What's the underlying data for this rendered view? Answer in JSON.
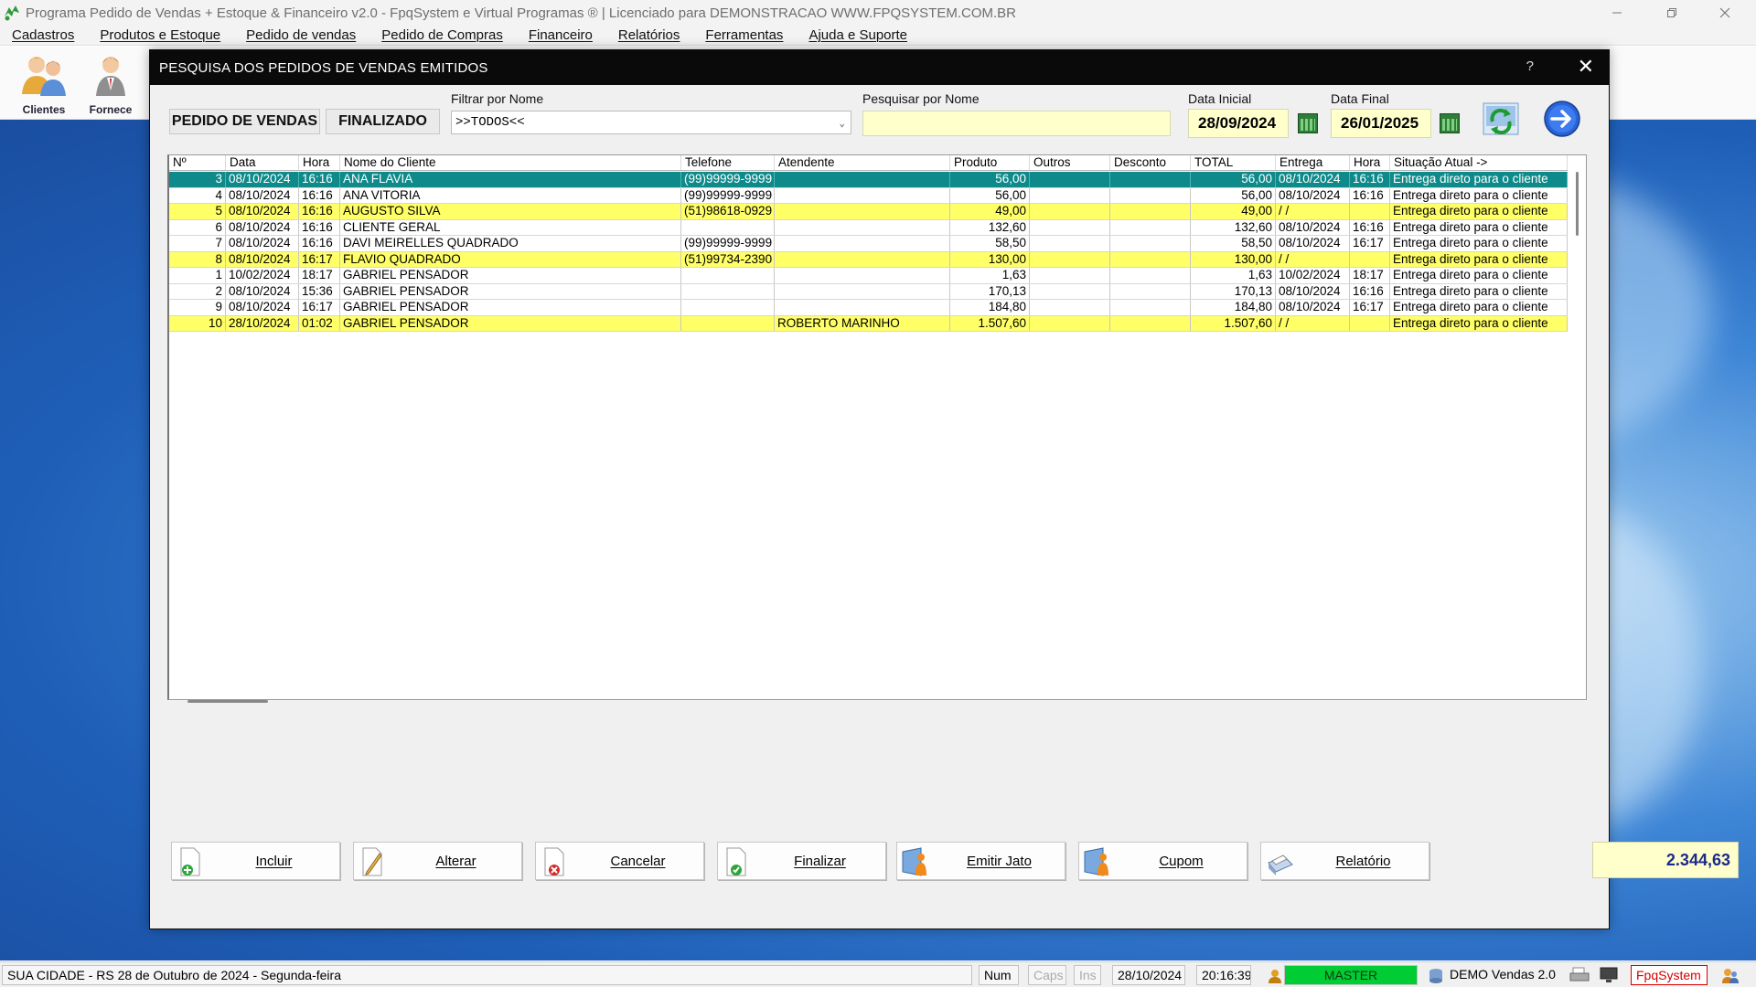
{
  "window": {
    "title": "Programa Pedido de Vendas + Estoque & Financeiro v2.0 - FpqSystem e Virtual Programas ® | Licenciado para  DEMONSTRACAO WWW.FPQSYSTEM.COM.BR"
  },
  "menu": [
    "Cadastros",
    "Produtos e Estoque",
    "Pedido de vendas",
    "Pedido de Compras",
    "Financeiro",
    "Relatórios",
    "Ferramentas",
    "Ajuda e Suporte"
  ],
  "toolbar": {
    "clientes": "Clientes",
    "fornece": "Fornece"
  },
  "dialog": {
    "title": "PESQUISA DOS PEDIDOS DE VENDAS EMITIDOS",
    "help": "?",
    "close": "✕",
    "btn_pedido": "PEDIDO DE VENDAS",
    "btn_finalizado": "FINALIZADO",
    "filtrar_label": "Filtrar por Nome",
    "filtrar_value": ">>TODOS<<",
    "pesquisar_label": "Pesquisar por Nome",
    "pesquisar_value": "",
    "data_inicial_label": "Data Inicial",
    "data_inicial": "28/09/2024",
    "data_final_label": "Data Final",
    "data_final": "26/01/2025"
  },
  "grid": {
    "columns": [
      "Nº",
      "Data",
      "Hora",
      "Nome do Cliente",
      "Telefone",
      "Atendente",
      "Produto",
      "Outros",
      "Desconto",
      "TOTAL",
      "Entrega",
      "Hora",
      "Situação Atual   ->"
    ],
    "rows": [
      {
        "n": "3",
        "data": "08/10/2024",
        "hora": "16:16",
        "cliente": "ANA FLAVIA",
        "tel": "(99)99999-9999",
        "atend": "",
        "produto": "56,00",
        "outros": "",
        "desc": "",
        "total": "56,00",
        "entrega": "08/10/2024",
        "hora2": "16:16",
        "situacao": "Entrega direto para o cliente",
        "style": "sel"
      },
      {
        "n": "4",
        "data": "08/10/2024",
        "hora": "16:16",
        "cliente": "ANA VITORIA",
        "tel": "(99)99999-9999",
        "atend": "",
        "produto": "56,00",
        "outros": "",
        "desc": "",
        "total": "56,00",
        "entrega": "08/10/2024",
        "hora2": "16:16",
        "situacao": "Entrega direto para o cliente",
        "style": ""
      },
      {
        "n": "5",
        "data": "08/10/2024",
        "hora": "16:16",
        "cliente": "AUGUSTO SILVA",
        "tel": "(51)98618-0929",
        "atend": "",
        "produto": "49,00",
        "outros": "",
        "desc": "",
        "total": "49,00",
        "entrega": " /  /",
        "hora2": "",
        "situacao": "Entrega direto para o cliente",
        "style": "yellow"
      },
      {
        "n": "6",
        "data": "08/10/2024",
        "hora": "16:16",
        "cliente": "CLIENTE GERAL",
        "tel": "",
        "atend": "",
        "produto": "132,60",
        "outros": "",
        "desc": "",
        "total": "132,60",
        "entrega": "08/10/2024",
        "hora2": "16:16",
        "situacao": "Entrega direto para o cliente",
        "style": ""
      },
      {
        "n": "7",
        "data": "08/10/2024",
        "hora": "16:16",
        "cliente": "DAVI MEIRELLES QUADRADO",
        "tel": "(99)99999-9999",
        "atend": "",
        "produto": "58,50",
        "outros": "",
        "desc": "",
        "total": "58,50",
        "entrega": "08/10/2024",
        "hora2": "16:17",
        "situacao": "Entrega direto para o cliente",
        "style": ""
      },
      {
        "n": "8",
        "data": "08/10/2024",
        "hora": "16:17",
        "cliente": "FLAVIO QUADRADO",
        "tel": "(51)99734-2390",
        "atend": "",
        "produto": "130,00",
        "outros": "",
        "desc": "",
        "total": "130,00",
        "entrega": " /  /",
        "hora2": "",
        "situacao": "Entrega direto para o cliente",
        "style": "yellow"
      },
      {
        "n": "1",
        "data": "10/02/2024",
        "hora": "18:17",
        "cliente": "GABRIEL PENSADOR",
        "tel": "",
        "atend": "",
        "produto": "1,63",
        "outros": "",
        "desc": "",
        "total": "1,63",
        "entrega": "10/02/2024",
        "hora2": "18:17",
        "situacao": "Entrega direto para o cliente",
        "style": ""
      },
      {
        "n": "2",
        "data": "08/10/2024",
        "hora": "15:36",
        "cliente": "GABRIEL PENSADOR",
        "tel": "",
        "atend": "",
        "produto": "170,13",
        "outros": "",
        "desc": "",
        "total": "170,13",
        "entrega": "08/10/2024",
        "hora2": "16:16",
        "situacao": "Entrega direto para o cliente",
        "style": ""
      },
      {
        "n": "9",
        "data": "08/10/2024",
        "hora": "16:17",
        "cliente": "GABRIEL PENSADOR",
        "tel": "",
        "atend": "",
        "produto": "184,80",
        "outros": "",
        "desc": "",
        "total": "184,80",
        "entrega": "08/10/2024",
        "hora2": "16:17",
        "situacao": "Entrega direto para o cliente",
        "style": ""
      },
      {
        "n": "10",
        "data": "28/10/2024",
        "hora": "01:02",
        "cliente": "GABRIEL PENSADOR",
        "tel": "",
        "atend": "ROBERTO MARINHO",
        "produto": "1.507,60",
        "outros": "",
        "desc": "",
        "total": "1.507,60",
        "entrega": " /  /",
        "hora2": "",
        "situacao": "Entrega direto para o cliente",
        "style": "yellow"
      }
    ]
  },
  "actions": {
    "incluir": "Incluir",
    "alterar": "Alterar",
    "cancelar": "Cancelar",
    "finalizar": "Finalizar",
    "emitir_jato": "Emitir Jato",
    "cupom": "Cupom",
    "relatorio": "Relatório",
    "total": "2.344,63"
  },
  "statusbar": {
    "location": "SUA CIDADE - RS 28 de Outubro de 2024 - Segunda-feira",
    "num": "Num",
    "caps": "Caps",
    "ins": "Ins",
    "date": "28/10/2024",
    "time": "20:16:39",
    "user": "MASTER",
    "demo": "DEMO Vendas 2.0",
    "brand": "FpqSystem"
  },
  "colors": {
    "selected_row": "#0f8a8a",
    "yellow_row": "#ffff66",
    "total_text": "#1c2a8c",
    "status_green": "#00cc33",
    "brand_red": "#d40000"
  }
}
